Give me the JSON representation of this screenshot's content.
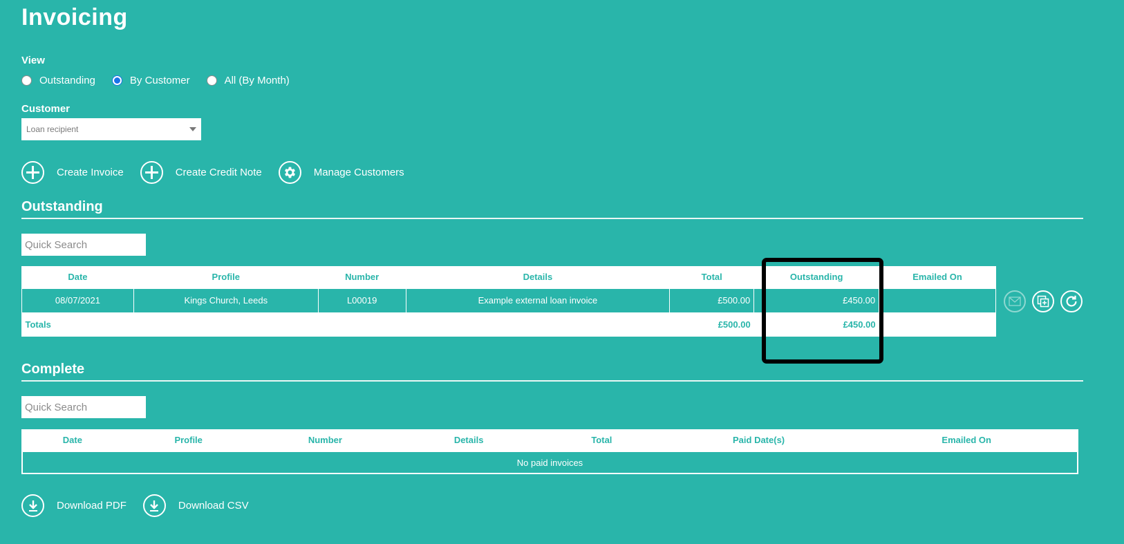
{
  "page": {
    "title": "Invoicing"
  },
  "view": {
    "label": "View",
    "options": [
      {
        "label": "Outstanding",
        "checked": false
      },
      {
        "label": "By Customer",
        "checked": true
      },
      {
        "label": "All (By Month)",
        "checked": false
      }
    ]
  },
  "customer": {
    "label": "Customer",
    "selected": "Loan recipient"
  },
  "actions": {
    "create_invoice": "Create Invoice",
    "create_credit_note": "Create Credit Note",
    "manage_customers": "Manage Customers"
  },
  "outstanding": {
    "title": "Outstanding",
    "search_placeholder": "Quick Search",
    "columns": [
      "Date",
      "Profile",
      "Number",
      "Details",
      "Total",
      "Outstanding",
      "Emailed On"
    ],
    "rows": [
      {
        "date": "08/07/2021",
        "profile": "Kings Church, Leeds",
        "number": "L00019",
        "details": "Example external loan invoice",
        "total": "£500.00",
        "outstanding": "£450.00",
        "emailed_on": ""
      }
    ],
    "totals": {
      "label": "Totals",
      "total": "£500.00",
      "outstanding": "£450.00"
    }
  },
  "complete": {
    "title": "Complete",
    "search_placeholder": "Quick Search",
    "columns": [
      "Date",
      "Profile",
      "Number",
      "Details",
      "Total",
      "Paid Date(s)",
      "Emailed On"
    ],
    "empty_message": "No paid invoices"
  },
  "downloads": {
    "pdf": "Download PDF",
    "csv": "Download CSV"
  },
  "colors": {
    "background": "#29b5aa",
    "radio_accent": "#1a73e8",
    "highlight": "#000000"
  }
}
